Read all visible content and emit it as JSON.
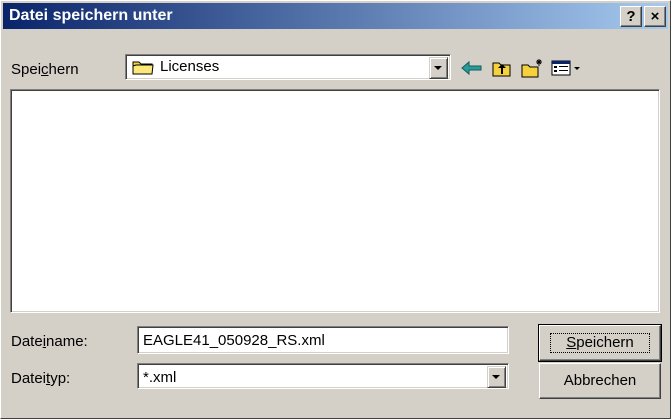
{
  "window": {
    "title": "Datei speichern unter",
    "help_button": "?",
    "close_button": "×"
  },
  "save_in": {
    "label_pre": "Spei",
    "label_u": "c",
    "label_post": "hern",
    "folder": "Licenses"
  },
  "toolbar": {
    "back_icon": "back-arrow-icon",
    "up_icon": "folder-up-icon",
    "new_folder_icon": "new-folder-icon",
    "view_icon": "view-menu-icon"
  },
  "filename": {
    "label_pre": "Date",
    "label_u": "i",
    "label_post": "name:",
    "value": "EAGLE41_050928_RS.xml"
  },
  "filetype": {
    "label_pre": "Datei",
    "label_u": "t",
    "label_post": "yp:",
    "value": "*.xml"
  },
  "buttons": {
    "save_u": "S",
    "save_rest": "peichern",
    "cancel": "Abbrechen"
  },
  "colors": {
    "title_start": "#0a246a",
    "title_end": "#a6caf0",
    "face": "#d4d0c8",
    "folder": "#f5d23d",
    "back_arrow": "#2a9d9a"
  }
}
